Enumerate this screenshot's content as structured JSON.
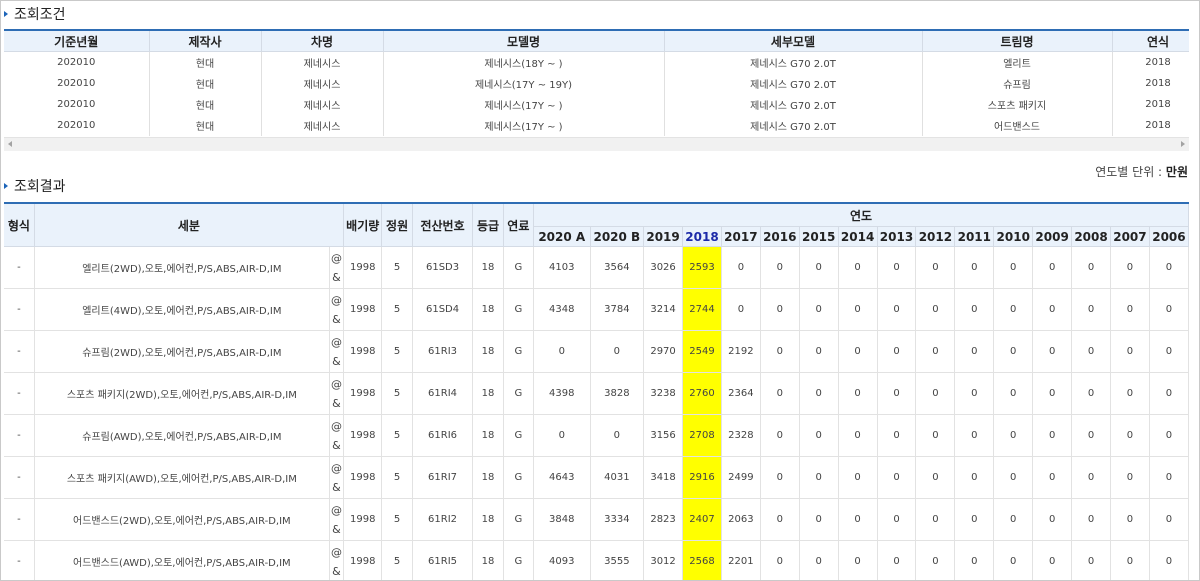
{
  "condition": {
    "title": "조회조건",
    "headers": [
      "기준년월",
      "제작사",
      "차명",
      "모델명",
      "세부모델",
      "트림명",
      "연식"
    ],
    "rows": [
      [
        "202010",
        "현대",
        "제네시스",
        "제네시스(18Y ~ )",
        "제네시스 G70 2.0T",
        "엘리트",
        "2018"
      ],
      [
        "202010",
        "현대",
        "제네시스",
        "제네시스(17Y ~ 19Y)",
        "제네시스 G70 2.0T",
        "슈프림",
        "2018"
      ],
      [
        "202010",
        "현대",
        "제네시스",
        "제네시스(17Y ~ )",
        "제네시스 G70 2.0T",
        "스포츠 패키지",
        "2018"
      ],
      [
        "202010",
        "현대",
        "제네시스",
        "제네시스(17Y ~ )",
        "제네시스 G70 2.0T",
        "어드밴스드",
        "2018"
      ]
    ]
  },
  "result": {
    "title": "조회결과",
    "unit_label": "연도별 단위 : ",
    "unit_value": "만원",
    "headers": {
      "type": "형식",
      "detail": "세분",
      "displacement": "배기량",
      "seats": "정원",
      "code": "전산번호",
      "grade": "등급",
      "fuel": "연료",
      "years_group": "연도"
    },
    "years": [
      "2020 A",
      "2020 B",
      "2019",
      "2018",
      "2017",
      "2016",
      "2015",
      "2014",
      "2013",
      "2012",
      "2011",
      "2010",
      "2009",
      "2008",
      "2007",
      "2006"
    ],
    "highlight_year_index": 3,
    "rows": [
      {
        "type": "-",
        "detail": "엘리트(2WD),오토,에어컨,P/S,ABS,AIR-D,IM",
        "sym1": "@",
        "sym2": "&",
        "displacement": "1998",
        "seats": "5",
        "code": "61SD3",
        "grade": "18",
        "fuel": "G",
        "values": [
          "4103",
          "3564",
          "3026",
          "2593",
          "0",
          "0",
          "0",
          "0",
          "0",
          "0",
          "0",
          "0",
          "0",
          "0",
          "0",
          "0"
        ]
      },
      {
        "type": "-",
        "detail": "엘리트(4WD),오토,에어컨,P/S,ABS,AIR-D,IM",
        "sym1": "@",
        "sym2": "&",
        "displacement": "1998",
        "seats": "5",
        "code": "61SD4",
        "grade": "18",
        "fuel": "G",
        "values": [
          "4348",
          "3784",
          "3214",
          "2744",
          "0",
          "0",
          "0",
          "0",
          "0",
          "0",
          "0",
          "0",
          "0",
          "0",
          "0",
          "0"
        ]
      },
      {
        "type": "-",
        "detail": "슈프림(2WD),오토,에어컨,P/S,ABS,AIR-D,IM",
        "sym1": "@",
        "sym2": "&",
        "displacement": "1998",
        "seats": "5",
        "code": "61RI3",
        "grade": "18",
        "fuel": "G",
        "values": [
          "0",
          "0",
          "2970",
          "2549",
          "2192",
          "0",
          "0",
          "0",
          "0",
          "0",
          "0",
          "0",
          "0",
          "0",
          "0",
          "0"
        ]
      },
      {
        "type": "-",
        "detail": "스포츠 패키지(2WD),오토,에어컨,P/S,ABS,AIR-D,IM",
        "sym1": "@",
        "sym2": "&",
        "displacement": "1998",
        "seats": "5",
        "code": "61RI4",
        "grade": "18",
        "fuel": "G",
        "values": [
          "4398",
          "3828",
          "3238",
          "2760",
          "2364",
          "0",
          "0",
          "0",
          "0",
          "0",
          "0",
          "0",
          "0",
          "0",
          "0",
          "0"
        ]
      },
      {
        "type": "-",
        "detail": "슈프림(AWD),오토,에어컨,P/S,ABS,AIR-D,IM",
        "sym1": "@",
        "sym2": "&",
        "displacement": "1998",
        "seats": "5",
        "code": "61RI6",
        "grade": "18",
        "fuel": "G",
        "values": [
          "0",
          "0",
          "3156",
          "2708",
          "2328",
          "0",
          "0",
          "0",
          "0",
          "0",
          "0",
          "0",
          "0",
          "0",
          "0",
          "0"
        ]
      },
      {
        "type": "-",
        "detail": "스포츠 패키지(AWD),오토,에어컨,P/S,ABS,AIR-D,IM",
        "sym1": "@",
        "sym2": "&",
        "displacement": "1998",
        "seats": "5",
        "code": "61RI7",
        "grade": "18",
        "fuel": "G",
        "values": [
          "4643",
          "4031",
          "3418",
          "2916",
          "2499",
          "0",
          "0",
          "0",
          "0",
          "0",
          "0",
          "0",
          "0",
          "0",
          "0",
          "0"
        ]
      },
      {
        "type": "-",
        "detail": "어드밴스드(2WD),오토,에어컨,P/S,ABS,AIR-D,IM",
        "sym1": "@",
        "sym2": "&",
        "displacement": "1998",
        "seats": "5",
        "code": "61RI2",
        "grade": "18",
        "fuel": "G",
        "values": [
          "3848",
          "3334",
          "2823",
          "2407",
          "2063",
          "0",
          "0",
          "0",
          "0",
          "0",
          "0",
          "0",
          "0",
          "0",
          "0",
          "0"
        ]
      },
      {
        "type": "-",
        "detail": "어드밴스드(AWD),오토,에어컨,P/S,ABS,AIR-D,IM",
        "sym1": "@",
        "sym2": "&",
        "displacement": "1998",
        "seats": "5",
        "code": "61RI5",
        "grade": "18",
        "fuel": "G",
        "values": [
          "4093",
          "3555",
          "3012",
          "2568",
          "2201",
          "0",
          "0",
          "0",
          "0",
          "0",
          "0",
          "0",
          "0",
          "0",
          "0",
          "0"
        ]
      }
    ]
  },
  "colors": {
    "accent_blue": "#2e6db4",
    "header_bg": "#eaf2fb",
    "highlight_bg": "#ffff00",
    "highlight_header_text": "#1c2aa8"
  }
}
